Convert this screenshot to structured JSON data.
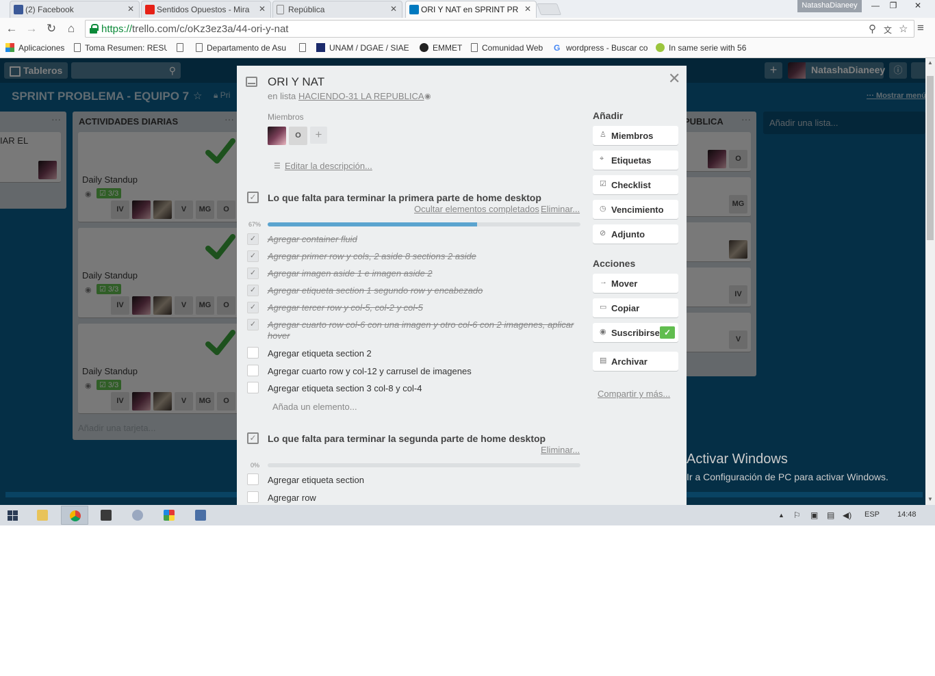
{
  "browser": {
    "tabs": [
      {
        "title": "(2) Facebook",
        "favicon": "facebook-icon",
        "color": "#3b5998"
      },
      {
        "title": "Sentidos Opuestos - Mira",
        "favicon": "youtube-icon",
        "color": "#e62117"
      },
      {
        "title": "República",
        "favicon": "page-icon",
        "color": "#888888"
      },
      {
        "title": "ORI Y NAT en SPRINT PRO",
        "favicon": "trello-icon",
        "color": "#0079bf"
      }
    ],
    "profile_name": "NatashaDianeey",
    "url_scheme": "https://",
    "url_rest": "trello.com/c/oKz3ez3a/44-ori-y-nat",
    "bookmarks": [
      "Aplicaciones",
      "Toma Resumen: RESU",
      "",
      "Departamento de Asu",
      "UNAM / DGAE / SIAE",
      "EMMET",
      "Comunidad Web",
      "wordpress - Buscar co",
      "In same serie with 56"
    ]
  },
  "trello": {
    "boards_label": "Tableros",
    "user_name": "NatashaDianeey",
    "board_title": "SPRINT PROBLEMA - EQUIPO 7",
    "privacy_label": "Pri",
    "show_menu": "Mostrar menú",
    "list_left_fragment": "IAR EL",
    "list_daily_title": "ACTIVIDADES DIARIAS",
    "daily_cards": [
      {
        "title": "Daily Standup",
        "badge": "3/3"
      },
      {
        "title": "Daily Standup",
        "badge": "3/3"
      },
      {
        "title": "Daily Standup",
        "badge": "3/3"
      }
    ],
    "member_initials": [
      "IV",
      "V",
      "MG",
      "O"
    ],
    "add_card": "Añadir una tarjeta...",
    "list_right_fragment": "PUBLICA",
    "right_badges": [
      "O",
      "MG",
      "IV",
      "V"
    ],
    "add_list": "Añadir una lista..."
  },
  "modal": {
    "title": "ORI Y NAT",
    "in_list_prefix": "en lista",
    "list_name": "HACIENDO-31 LA REPUBLICA",
    "members_label": "Miembros",
    "member_initial": "O",
    "edit_description": "Editar la descripción...",
    "checklists": [
      {
        "title": "Lo que falta para terminar la primera parte de home desktop",
        "hide_completed": "Ocultar elementos completados",
        "delete": "Eliminar...",
        "percent": "67%",
        "progress": 0.67,
        "items": [
          {
            "text": "Agregar container fluid",
            "done": true
          },
          {
            "text": "Agregar primer row y cols, 2 aside  8 sections  2 aside",
            "done": true
          },
          {
            "text": "Agregar imagen aside 1 e imagen aside 2",
            "done": true
          },
          {
            "text": "Agregar etiqueta section 1 segundo row y encabezado",
            "done": true
          },
          {
            "text": "Agregar tercer row y col-5, col-2 y col-5",
            "done": true
          },
          {
            "text": "Agregar cuarto row col-6 con una imagen y otro col-6 con 2 imagenes, aplicar hover",
            "done": true
          },
          {
            "text": "Agregar etiqueta section 2",
            "done": false
          },
          {
            "text": "Agregar cuarto row y col-12 y carrusel de imagenes",
            "done": false
          },
          {
            "text": "Agregar etiqueta section 3 col-8 y col-4",
            "done": false
          }
        ],
        "add_item": "Añada un elemento..."
      },
      {
        "title": "Lo que falta para terminar la segunda parte de home desktop",
        "delete": "Eliminar...",
        "percent": "0%",
        "progress": 0,
        "items": [
          {
            "text": "Agregar etiqueta section",
            "done": false
          },
          {
            "text": "Agregar row",
            "done": false
          }
        ]
      }
    ],
    "sidebar": {
      "add_heading": "Añadir",
      "add_buttons": [
        {
          "label": "Miembros",
          "icon": "person-icon"
        },
        {
          "label": "Etiquetas",
          "icon": "tag-icon"
        },
        {
          "label": "Checklist",
          "icon": "checklist-icon"
        },
        {
          "label": "Vencimiento",
          "icon": "clock-icon"
        },
        {
          "label": "Adjunto",
          "icon": "paperclip-icon"
        }
      ],
      "actions_heading": "Acciones",
      "action_buttons": [
        {
          "label": "Mover",
          "icon": "arrow-right-icon"
        },
        {
          "label": "Copiar",
          "icon": "copy-icon"
        },
        {
          "label": "Suscribirse",
          "icon": "eye-icon"
        },
        {
          "label": "Archivar",
          "icon": "archive-icon"
        }
      ],
      "share": "Compartir y más..."
    }
  },
  "windows": {
    "activate_title": "Activar Windows",
    "activate_sub": "Ir a Configuración de PC para activar Windows.",
    "language": "ESP",
    "time": "14:48"
  }
}
